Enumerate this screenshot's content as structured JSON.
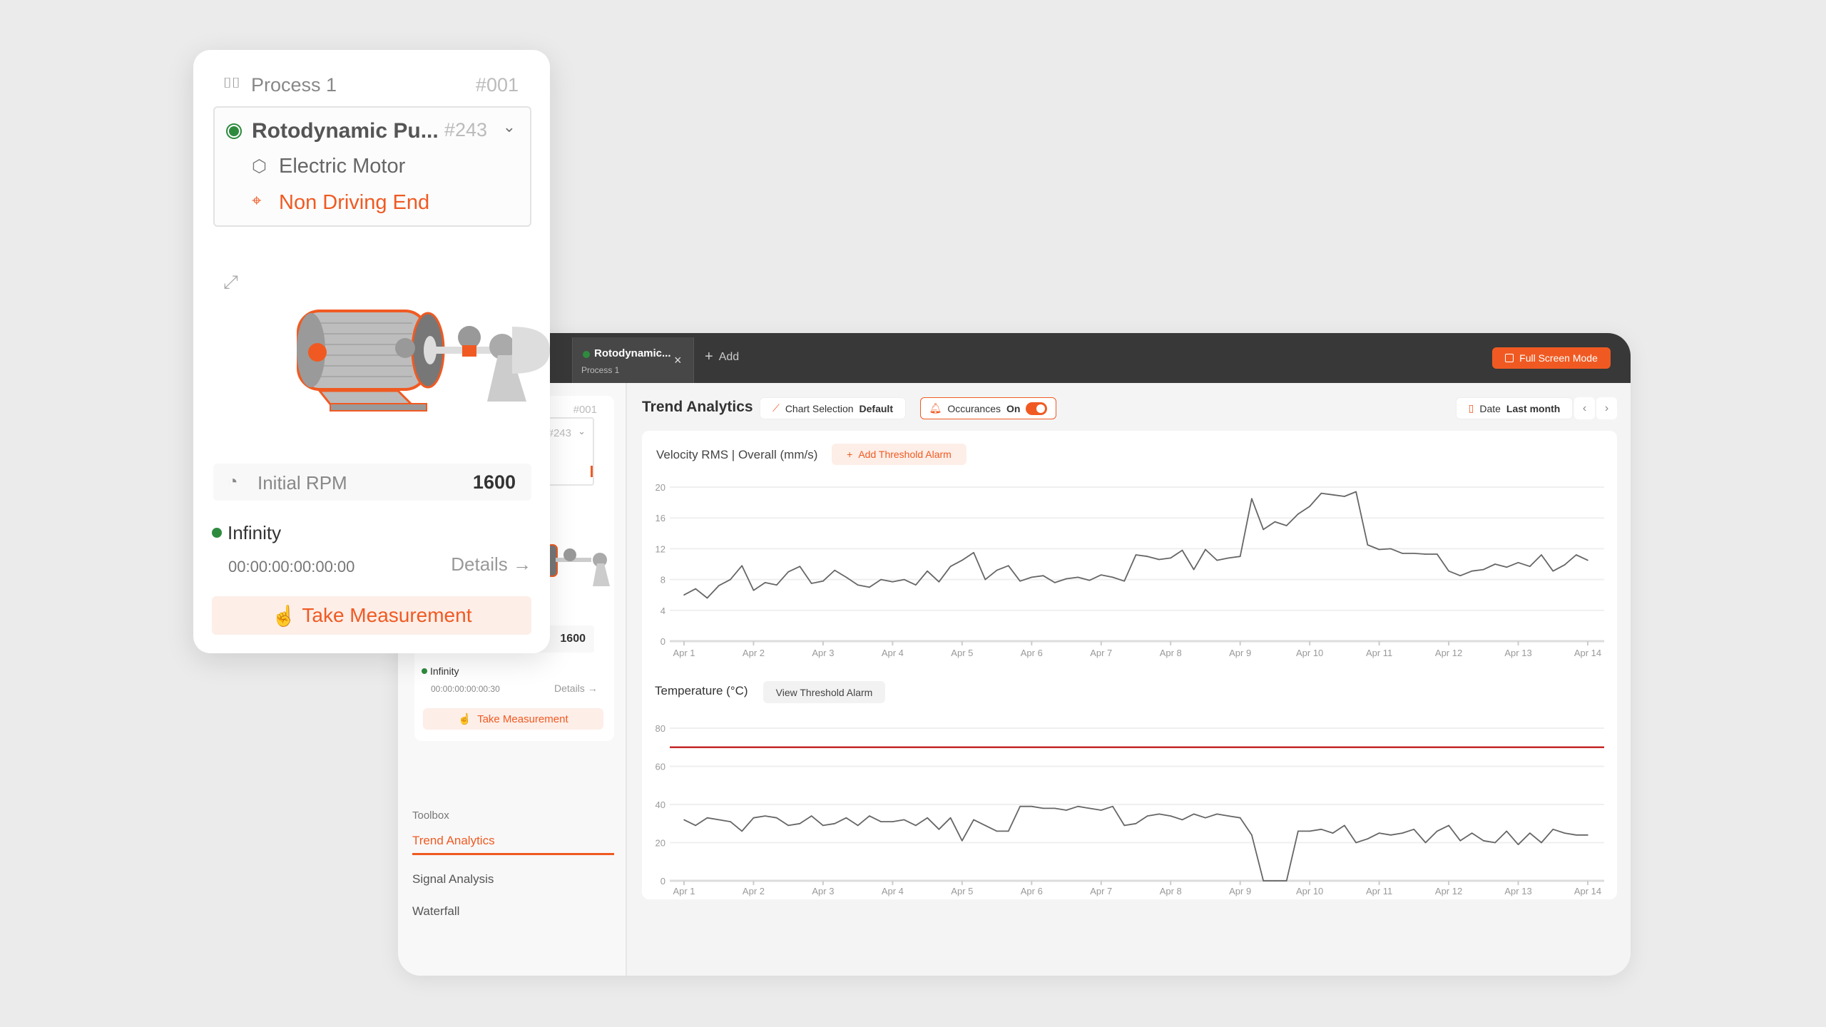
{
  "card": {
    "process_name": "Process 1",
    "process_id": "#001",
    "asset_name": "Rotodynamic Pu...",
    "asset_id": "#243",
    "component": "Electric Motor",
    "location": "Non Driving End",
    "rpm_label": "Initial RPM",
    "rpm_value": "1600",
    "status_name": "Infinity",
    "timer": "00:00:00:00:00:00",
    "details_label": "Details",
    "take_measurement": "Take Measurement"
  },
  "sidebar": {
    "process_id": "#001",
    "asset_id": "#243",
    "rpm_value": "1600",
    "status_name": "Infinity",
    "timer": "00:00:00:00:00:30",
    "details_label": "Details",
    "take_measurement": "Take Measurement",
    "toolbox_label": "Toolbox",
    "tools": [
      {
        "label": "Trend Analytics",
        "active": true
      },
      {
        "label": "Signal Analysis",
        "active": false
      },
      {
        "label": "Waterfall",
        "active": false
      }
    ]
  },
  "topbar": {
    "tab_title": "Rotodynamic...",
    "tab_subtitle": "Process 1",
    "add_label": "Add",
    "fullscreen_label": "Full Screen Mode"
  },
  "toolbar": {
    "title": "Trend Analytics",
    "chart_selection_label": "Chart Selection",
    "chart_selection_value": "Default",
    "occurances_label": "Occurances",
    "occurances_value": "On",
    "occurances_enabled": true,
    "date_label": "Date",
    "date_value": "Last month"
  },
  "colors": {
    "accent": "#f05a22",
    "status_ok": "#2e8b3e",
    "threshold": "#c62828",
    "series": "#666666"
  },
  "chart_data": [
    {
      "type": "line",
      "title": "Velocity RMS | Overall (mm/s)",
      "action_label": "Add Threshold Alarm",
      "ylim": [
        0,
        20
      ],
      "yticks": [
        0,
        4,
        8,
        12,
        16,
        20
      ],
      "xticks": [
        "Apr 1",
        "Apr 2",
        "Apr 3",
        "Apr 4",
        "Apr 5",
        "Apr 6",
        "Apr 7",
        "Apr 8",
        "Apr 9",
        "Apr 10",
        "Apr 11",
        "Apr 12",
        "Apr 13",
        "Apr 14"
      ],
      "grid": true,
      "values": [
        6.0,
        6.8,
        5.6,
        7.2,
        8.0,
        9.8,
        6.6,
        7.6,
        7.3,
        9.0,
        9.7,
        7.5,
        7.8,
        9.2,
        8.3,
        7.3,
        7.0,
        8.0,
        7.7,
        8.0,
        7.3,
        9.1,
        7.7,
        9.7,
        10.5,
        11.5,
        8.0,
        9.2,
        9.8,
        7.8,
        8.3,
        8.5,
        7.6,
        8.1,
        8.3,
        7.9,
        8.6,
        8.3,
        7.8,
        11.2,
        11.0,
        10.6,
        10.8,
        11.8,
        9.3,
        11.9,
        10.5,
        10.8,
        11.0,
        18.5,
        14.5,
        15.5,
        15.0,
        16.5,
        17.5,
        19.2,
        19.0,
        18.8,
        19.4,
        12.5,
        11.9,
        12.0,
        11.4,
        11.4,
        11.3,
        11.3,
        9.1,
        8.5,
        9.1,
        9.3,
        10.0,
        9.6,
        10.2,
        9.7,
        11.2,
        9.1,
        9.9,
        11.2,
        10.5
      ]
    },
    {
      "type": "line",
      "title": "Temperature (°C)",
      "action_label": "View Threshold Alarm",
      "ylim": [
        0,
        80
      ],
      "yticks": [
        0,
        20,
        40,
        60,
        80
      ],
      "xticks": [
        "Apr 1",
        "Apr 2",
        "Apr 3",
        "Apr 4",
        "Apr 5",
        "Apr 6",
        "Apr 7",
        "Apr 8",
        "Apr 9",
        "Apr 10",
        "Apr 11",
        "Apr 12",
        "Apr 13",
        "Apr 14"
      ],
      "grid": true,
      "threshold": 70,
      "values": [
        32,
        29,
        33,
        32,
        31,
        26,
        33,
        34,
        33,
        29,
        30,
        34,
        29,
        30,
        33,
        29,
        34,
        31,
        31,
        32,
        29,
        33,
        27,
        33,
        21,
        32,
        29,
        26,
        26,
        39,
        39,
        38,
        38,
        37,
        39,
        38,
        37,
        39,
        29,
        30,
        34,
        35,
        34,
        32,
        35,
        33,
        35,
        34,
        33,
        24,
        0,
        0,
        0,
        26,
        26,
        27,
        25,
        29,
        20,
        22,
        25,
        24,
        25,
        27,
        20,
        26,
        29,
        21,
        25,
        21,
        20,
        26,
        19,
        25,
        20,
        27,
        25,
        24,
        24
      ]
    }
  ]
}
